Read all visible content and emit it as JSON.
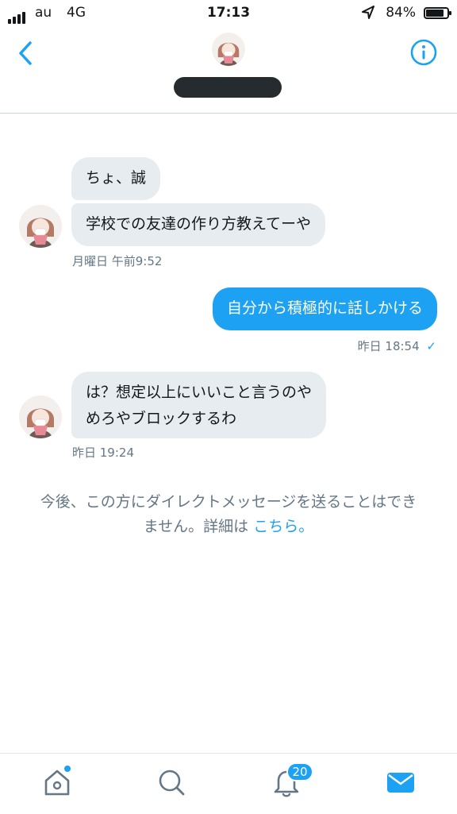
{
  "status_bar": {
    "carrier": "au",
    "network": "4G",
    "time": "17:13",
    "battery_percent": "84%",
    "battery_level": 0.84
  },
  "header": {
    "back_icon": "chevron-left-icon",
    "info_icon": "info-icon",
    "username": "[redacted]"
  },
  "messages": [
    {
      "direction": "in",
      "text": "ちょ、誠"
    },
    {
      "direction": "in",
      "text": "学校での友達の作り方教えてーや",
      "timestamp": "月曜日 午前9:52"
    },
    {
      "direction": "out",
      "text": "自分から積極的に話しかける",
      "timestamp": "昨日 18:54",
      "read_icon": "✓"
    },
    {
      "direction": "in",
      "lines": [
        "は？想定以上にいいこと言うのや",
        "めろやブロックするわ"
      ],
      "timestamp": "昨日 19:24"
    }
  ],
  "notice": {
    "line1": "今後、この方にダイレクトメッセージを送ることはでき",
    "line2": "ません。詳細は",
    "link": "こちら。"
  },
  "tabbar": {
    "notifications_badge": "20",
    "items": [
      "home-icon",
      "search-icon",
      "notifications-icon",
      "messages-icon"
    ],
    "active": "messages",
    "accent": "#1da1f2"
  }
}
